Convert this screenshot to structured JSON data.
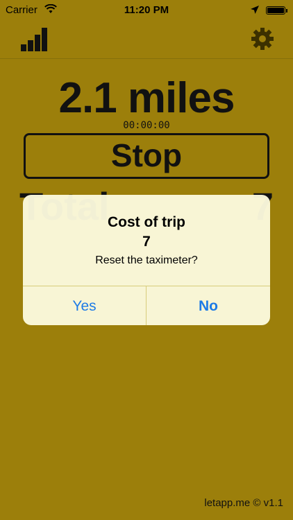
{
  "status_bar": {
    "carrier": "Carrier",
    "time": "11:20 PM",
    "icons": [
      "wifi-icon",
      "location-arrow-icon",
      "battery-icon"
    ]
  },
  "nav": {
    "left_icon": "bar-chart-icon",
    "right_icon": "gear-icon"
  },
  "trip": {
    "distance": "2.1 miles",
    "elapsed": "00:00:00",
    "stop_label": "Stop",
    "total_label": "Total",
    "total_value": "7"
  },
  "alert": {
    "title": "Cost of trip",
    "value": "7",
    "message": "Reset the taximeter?",
    "yes_label": "Yes",
    "no_label": "No"
  },
  "footer": {
    "text": "letapp.me © v1.1"
  },
  "colors": {
    "background": "#9c7f0b",
    "alert_background": "#fcfade",
    "button_text": "#1e7be6",
    "icon": "#111111"
  }
}
